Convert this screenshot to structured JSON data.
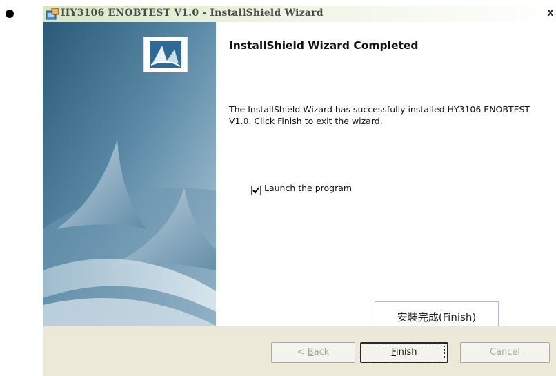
{
  "window": {
    "title": "HY3106 ENOBTEST V1.0 - InstallShield Wizard",
    "close_label": "x"
  },
  "main": {
    "heading": "InstallShield Wizard Completed",
    "message": "The InstallShield Wizard has successfully installed HY3106 ENOBTEST V1.0. Click Finish to exit the wizard.",
    "checkbox": {
      "label": "Launch the program",
      "checked": true
    }
  },
  "annotation": {
    "text": "安裝完成(Finish)"
  },
  "buttons": {
    "back": {
      "prefix": "< ",
      "mnemonic": "B",
      "rest": "ack",
      "enabled": false
    },
    "finish": {
      "mnemonic": "F",
      "rest": "inish",
      "enabled": true
    },
    "cancel": {
      "label": "Cancel",
      "enabled": false
    }
  },
  "colors": {
    "sidebar_dark": "#2e5e7c",
    "sidebar_light": "#a9c6d6",
    "bottom_bar": "#ece9d8",
    "callout_border": "#c9a9e8"
  },
  "icons": [
    "bullet",
    "installshield-app-icon",
    "close-icon",
    "wizard-logo-icon",
    "sail-graphic",
    "checkmark-icon"
  ]
}
